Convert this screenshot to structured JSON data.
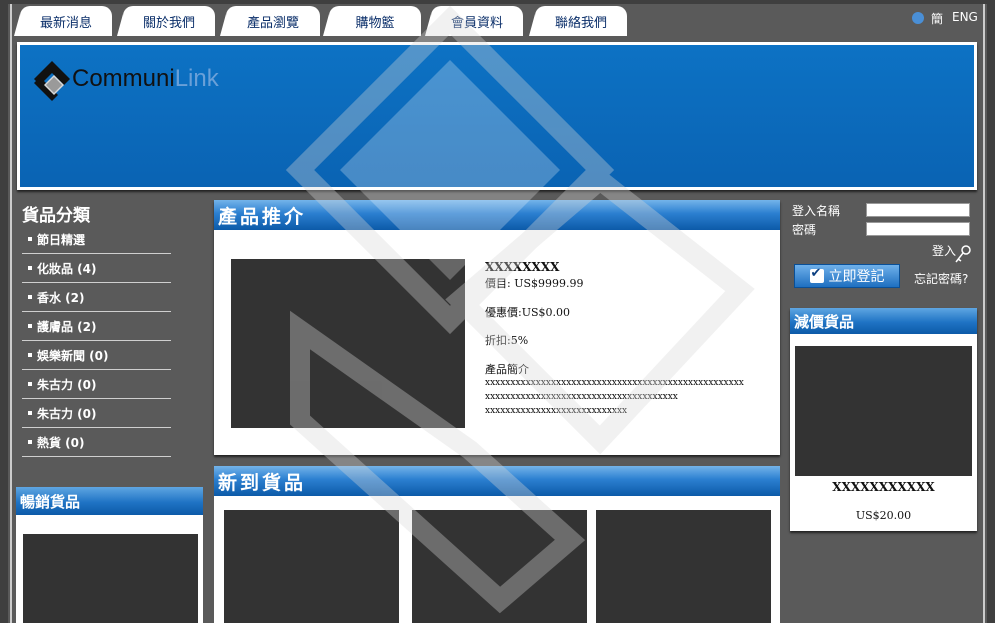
{
  "nav": {
    "tabs": [
      "最新消息",
      "關於我們",
      "產品瀏覽",
      "購物籃",
      "會員資料",
      "聯絡我們"
    ],
    "lang_simplified": "簡",
    "lang_english": "ENG"
  },
  "logo": {
    "part1": "Communi",
    "part2": "Link"
  },
  "categories": {
    "title": "貨品分類",
    "items": [
      "節日精選",
      "化妝品 (4)",
      "香水 (2)",
      "護膚品 (2)",
      "娛樂新聞 (0)",
      "朱古力 (0)",
      "朱古力 (0)",
      "熱貨 (0)"
    ]
  },
  "bestsellers": {
    "title": "暢銷貨品"
  },
  "featured": {
    "title": "產品推介",
    "name": "XXXXXXXX",
    "list_price": "價目: US$9999.99",
    "sale_price": "優惠價:US$0.00",
    "discount": "折扣:5%",
    "desc_label": "產品簡介",
    "desc_lines": [
      "xxxxxxxxxxxxxxxxxxxxxxxxxxxxxxxxxxxxxxxxxxxxxxxxxxx",
      "xxxxxxxxxxxxxxxxxxxxxxxxxxxxxxxxxxxxxx",
      "xxxxxxxxxxxxxxxxxxxxxxxxxxxx"
    ]
  },
  "new_arrivals": {
    "title": "新到貨品"
  },
  "login": {
    "username_label": "登入名稱",
    "password_label": "密碼",
    "login_link": "登入",
    "register_button": "立即登記",
    "forgot_password": "忘記密碼?"
  },
  "discounted": {
    "title": "減價貨品",
    "name": "XXXXXXXXXXX",
    "price": "US$20.00"
  },
  "colors": {
    "banner_blue": "#0a63b3",
    "background_gray": "#5a5a5a",
    "tab_text_navy": "#0b2f6a"
  }
}
